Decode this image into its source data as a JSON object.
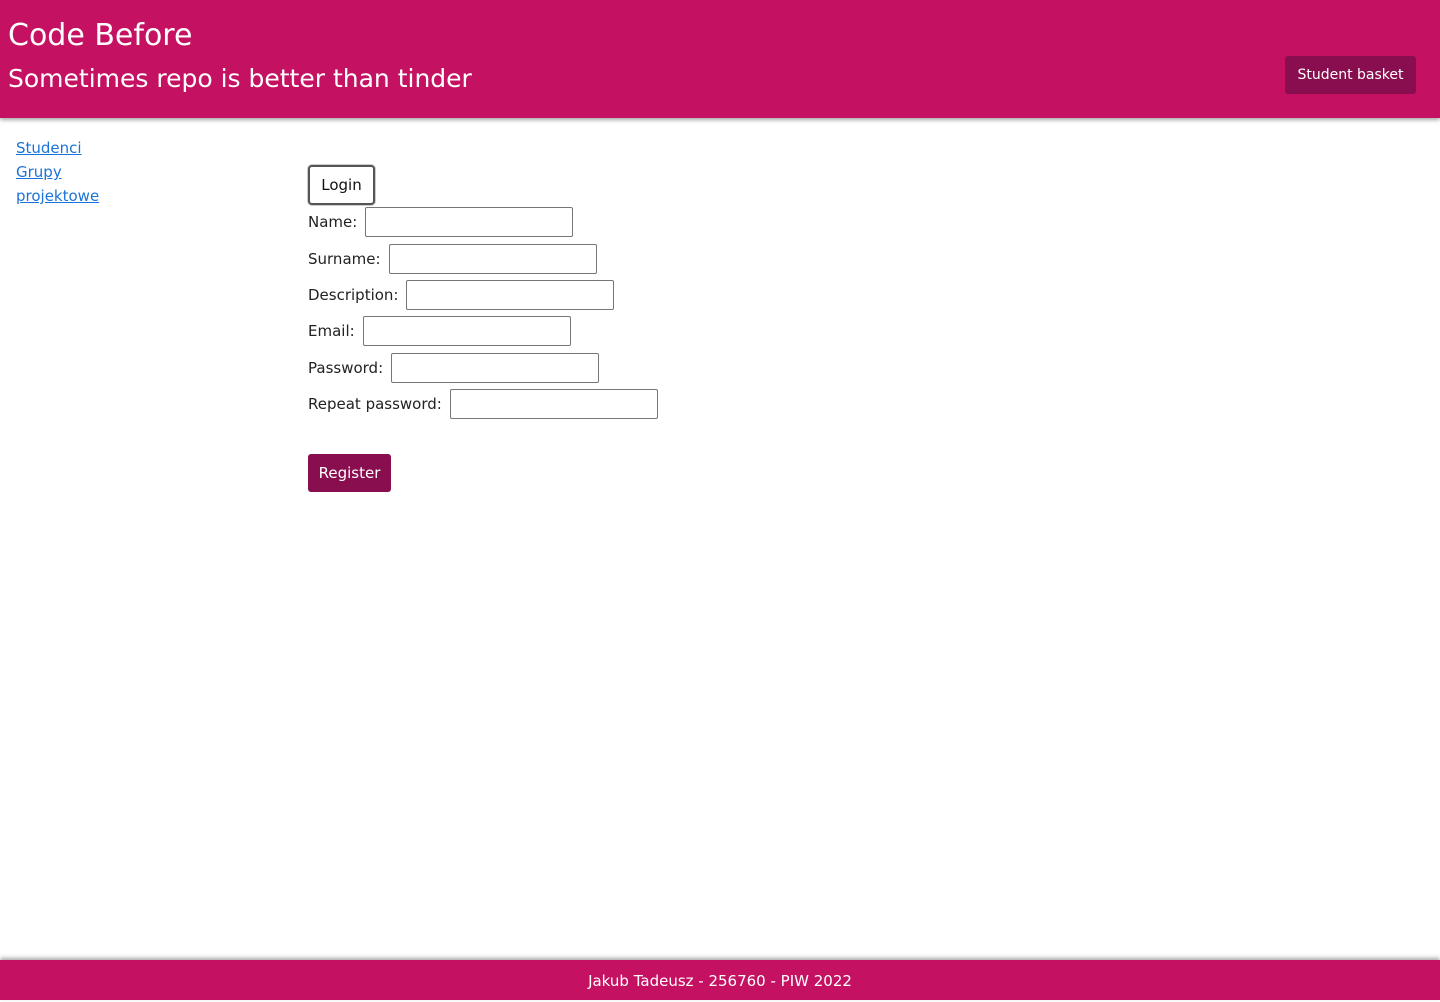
{
  "header": {
    "title": "Code Before",
    "subtitle": "Sometimes repo is better than tinder",
    "basket_label": "Student basket"
  },
  "sidebar": {
    "items": [
      {
        "label": "Studenci"
      },
      {
        "label": "Grupy projektowe"
      }
    ]
  },
  "form": {
    "login_label": "Login",
    "fields": [
      {
        "label": "Name:",
        "value": ""
      },
      {
        "label": "Surname:",
        "value": ""
      },
      {
        "label": "Description:",
        "value": ""
      },
      {
        "label": "Email:",
        "value": ""
      },
      {
        "label": "Password:",
        "value": ""
      },
      {
        "label": "Repeat password:",
        "value": ""
      }
    ],
    "register_label": "Register"
  },
  "footer": {
    "text": "Jakub Tadeusz - 256760 - PIW 2022"
  },
  "colors": {
    "primary": "#c51162",
    "accent_dark": "#880e4f",
    "link": "#1a73d9"
  }
}
